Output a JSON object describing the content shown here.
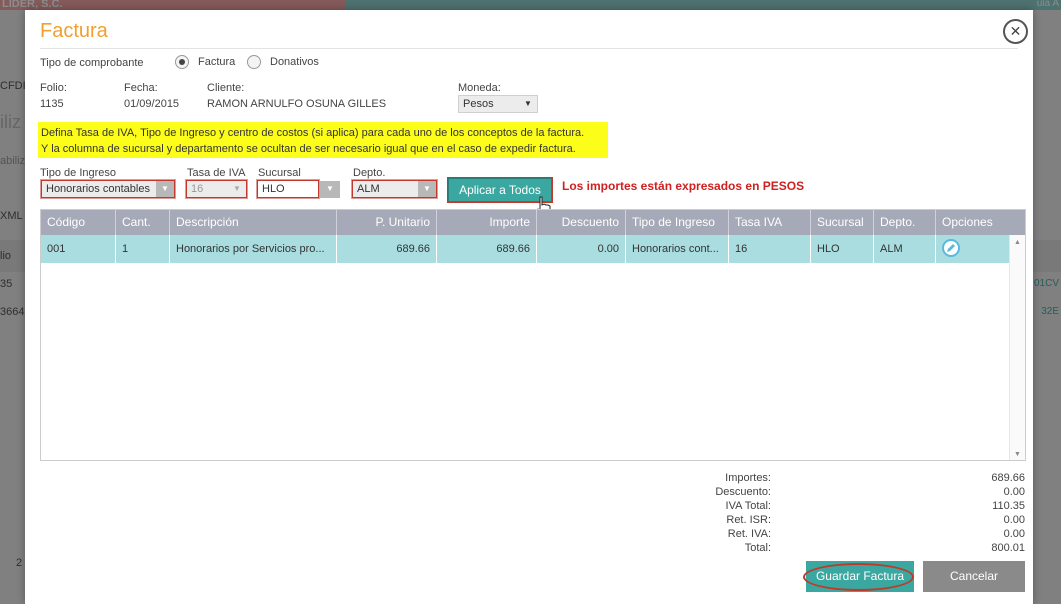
{
  "background": {
    "app_title": "LIDER, S.C.",
    "side_items": [
      "CFDI",
      "iliz",
      "abiliz",
      "XML",
      "lio",
      "35",
      "3664",
      "2"
    ],
    "right_items": [
      "01CV",
      "32E"
    ],
    "top_right": "ula A"
  },
  "modal": {
    "title": "Factura",
    "tipo_comprobante_label": "Tipo de comprobante",
    "radio_factura": "Factura",
    "radio_donativos": "Donativos",
    "folio_label": "Folio:",
    "folio_value": "1135",
    "fecha_label": "Fecha:",
    "fecha_value": "01/09/2015",
    "cliente_label": "Cliente:",
    "cliente_value": "RAMON ARNULFO OSUNA GILLES",
    "moneda_label": "Moneda:",
    "moneda_value": "Pesos",
    "notice_line1": "Defina Tasa de IVA, Tipo de Ingreso y centro de costos (si aplica) para cada uno de los conceptos de la factura.",
    "notice_line2": "Y la columna de sucursal y departamento se ocultan de ser necesario igual que en el caso de expedir factura.",
    "tipo_ingreso_label": "Tipo de Ingreso",
    "tipo_ingreso_value": "Honorarios contables",
    "tasa_iva_label": "Tasa de IVA",
    "tasa_iva_value": "16",
    "sucursal_label": "Sucursal",
    "sucursal_value": "HLO",
    "depto_label": "Depto.",
    "depto_value": "ALM",
    "apply_button": "Aplicar a Todos",
    "currency_note": "Los importes están expresados en PESOS"
  },
  "grid": {
    "columns": [
      "Código",
      "Cant.",
      "Descripción",
      "P. Unitario",
      "Importe",
      "Descuento",
      "Tipo de Ingreso",
      "Tasa IVA",
      "Sucursal",
      "Depto.",
      "Opciones"
    ],
    "rows": [
      [
        "001",
        "1",
        "Honorarios por Servicios pro...",
        "689.66",
        "689.66",
        "0.00",
        "Honorarios cont...",
        "16",
        "HLO",
        "ALM"
      ]
    ]
  },
  "totals": {
    "labels": [
      "Importes:",
      "Descuento:",
      "IVA Total:",
      "Ret. ISR:",
      "Ret. IVA:",
      "Total:"
    ],
    "values": [
      "689.66",
      "0.00",
      "110.35",
      "0.00",
      "0.00",
      "800.01"
    ]
  },
  "buttons": {
    "save": "Guardar Factura",
    "cancel": "Cancelar"
  },
  "colors": {
    "accent": "#3aa8a0",
    "title": "#f0a030",
    "highlight_row": "#a9dde0",
    "notice": "#fdfd1a",
    "alert": "#d02020"
  }
}
